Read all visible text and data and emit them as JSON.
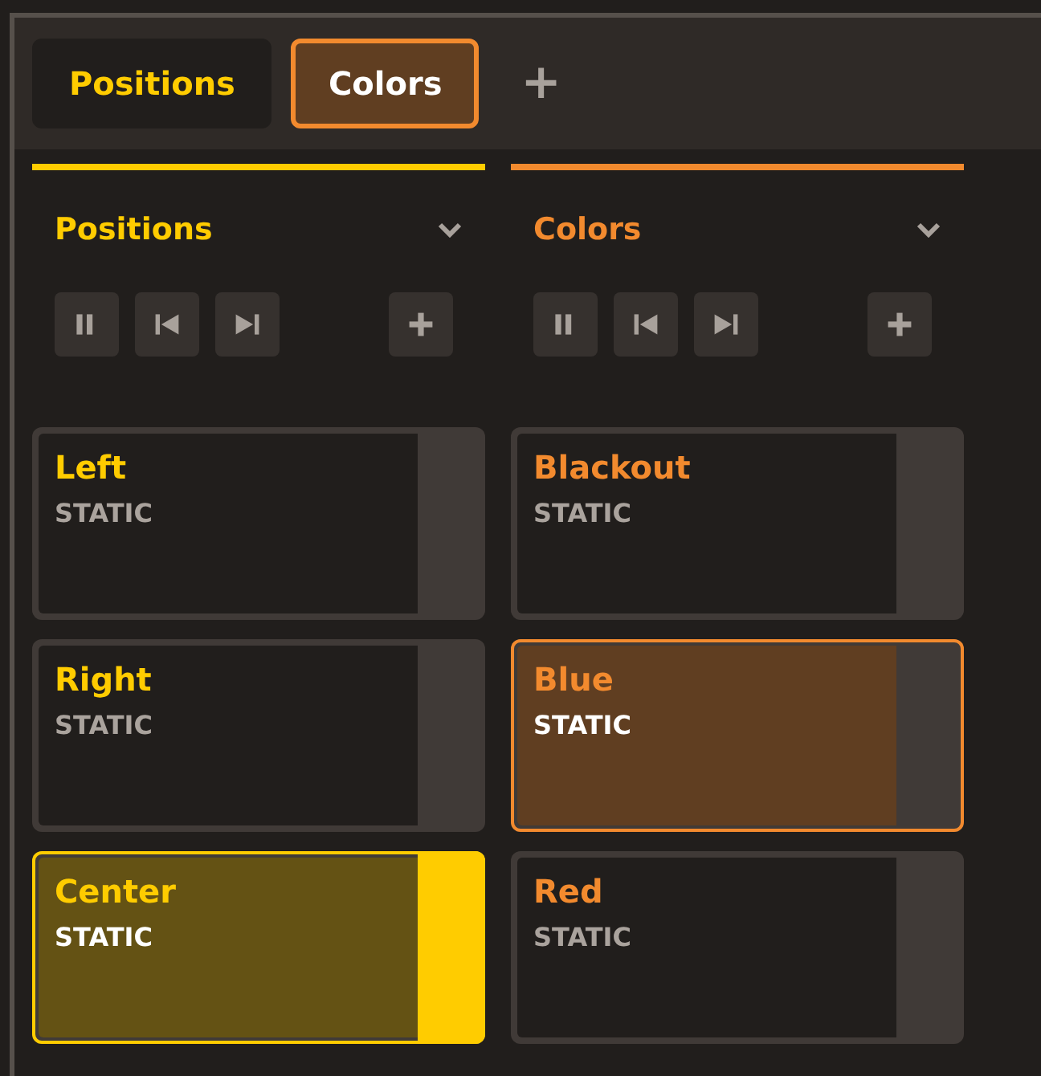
{
  "tabs": [
    {
      "label": "Positions",
      "selected": false,
      "color": "#ffcc00"
    },
    {
      "label": "Colors",
      "selected": true,
      "color": "#f28a2e"
    }
  ],
  "add_tab": "+",
  "groups": [
    {
      "title": "Positions",
      "color": "#ffcc00",
      "cues": [
        {
          "name": "Left",
          "type": "STATIC",
          "selected": false,
          "active": false
        },
        {
          "name": "Right",
          "type": "STATIC",
          "selected": false,
          "active": false
        },
        {
          "name": "Center",
          "type": "STATIC",
          "selected": true,
          "active": true
        }
      ]
    },
    {
      "title": "Colors",
      "color": "#f28a2e",
      "cues": [
        {
          "name": "Blackout",
          "type": "STATIC",
          "selected": false,
          "active": false
        },
        {
          "name": "Blue",
          "type": "STATIC",
          "selected": true,
          "active": false
        },
        {
          "name": "Red",
          "type": "STATIC",
          "selected": false,
          "active": false
        }
      ]
    }
  ]
}
